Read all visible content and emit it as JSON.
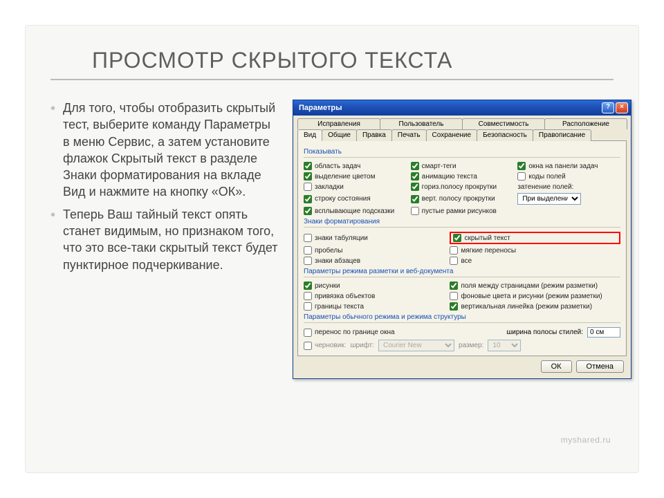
{
  "slide": {
    "title": "ПРОСМОТР СКРЫТОГО ТЕКСТА",
    "bullets": [
      "Для того, чтобы отобразить скрытый тест, выберите команду Параметры в меню Сервис, а затем установите флажок Скрытый текст в разделе Знаки форматирования на вкладе Вид и нажмите на кнопку «ОК».",
      "Теперь Ваш тайный текст опять станет видимым, но признаком того, что это все-таки скрытый текст будет пунктирное подчеркивание."
    ],
    "watermark": "myshared.ru"
  },
  "dialog": {
    "title": "Параметры",
    "help_btn": "?",
    "close_btn": "×",
    "tabs_top": [
      "Исправления",
      "Пользователь",
      "Совместимость",
      "Расположение"
    ],
    "tabs_bottom": [
      "Вид",
      "Общие",
      "Правка",
      "Печать",
      "Сохранение",
      "Безопасность",
      "Правописание"
    ],
    "active_tab": "Вид",
    "group_show": {
      "title": "Показывать",
      "col1": [
        {
          "label": "область задач",
          "checked": true
        },
        {
          "label": "выделение цветом",
          "checked": true
        },
        {
          "label": "закладки",
          "checked": false
        },
        {
          "label": "строку состояния",
          "checked": true
        },
        {
          "label": "всплывающие подсказки",
          "checked": true
        }
      ],
      "col2": [
        {
          "label": "смарт-теги",
          "checked": true
        },
        {
          "label": "анимацию текста",
          "checked": true
        },
        {
          "label": "гориз.полосу прокрутки",
          "checked": true
        },
        {
          "label": "верт. полосу прокрутки",
          "checked": true
        },
        {
          "label": "пустые рамки рисунков",
          "checked": false
        }
      ],
      "col3": [
        {
          "label": "окна на панели задач",
          "checked": true
        },
        {
          "label": "коды полей",
          "checked": false
        }
      ],
      "shading_label": "затенение полей:",
      "shading_value": "При выделении"
    },
    "group_marks": {
      "title": "Знаки форматирования",
      "col1": [
        {
          "label": "знаки табуляции",
          "checked": false
        },
        {
          "label": "пробелы",
          "checked": false
        },
        {
          "label": "знаки абзацев",
          "checked": false
        }
      ],
      "col2": [
        {
          "label": "скрытый текст",
          "checked": true,
          "highlight": true
        },
        {
          "label": "мягкие переносы",
          "checked": false
        },
        {
          "label": "все",
          "checked": false
        }
      ]
    },
    "group_layout": {
      "title": "Параметры режима разметки и веб-документа",
      "col1": [
        {
          "label": "рисунки",
          "checked": true
        },
        {
          "label": "привязка объектов",
          "checked": false
        },
        {
          "label": "границы текста",
          "checked": false
        }
      ],
      "col2": [
        {
          "label": "поля между страницами (режим разметки)",
          "checked": true
        },
        {
          "label": "фоновые цвета и рисунки (режим разметки)",
          "checked": false
        },
        {
          "label": "вертикальная линейка (режим разметки)",
          "checked": true
        }
      ]
    },
    "group_normal": {
      "title": "Параметры обычного режима и режима структуры",
      "wrap": {
        "label": "перенос по границе окна",
        "checked": false
      },
      "style_width_label": "ширина полосы стилей:",
      "style_width_value": "0 см",
      "draft": {
        "label": "черновик:",
        "checked": false
      },
      "font_label": "шрифт:",
      "font_value": "Courier New",
      "size_label": "размер:",
      "size_value": "10"
    },
    "ok": "ОК",
    "cancel": "Отмена"
  }
}
